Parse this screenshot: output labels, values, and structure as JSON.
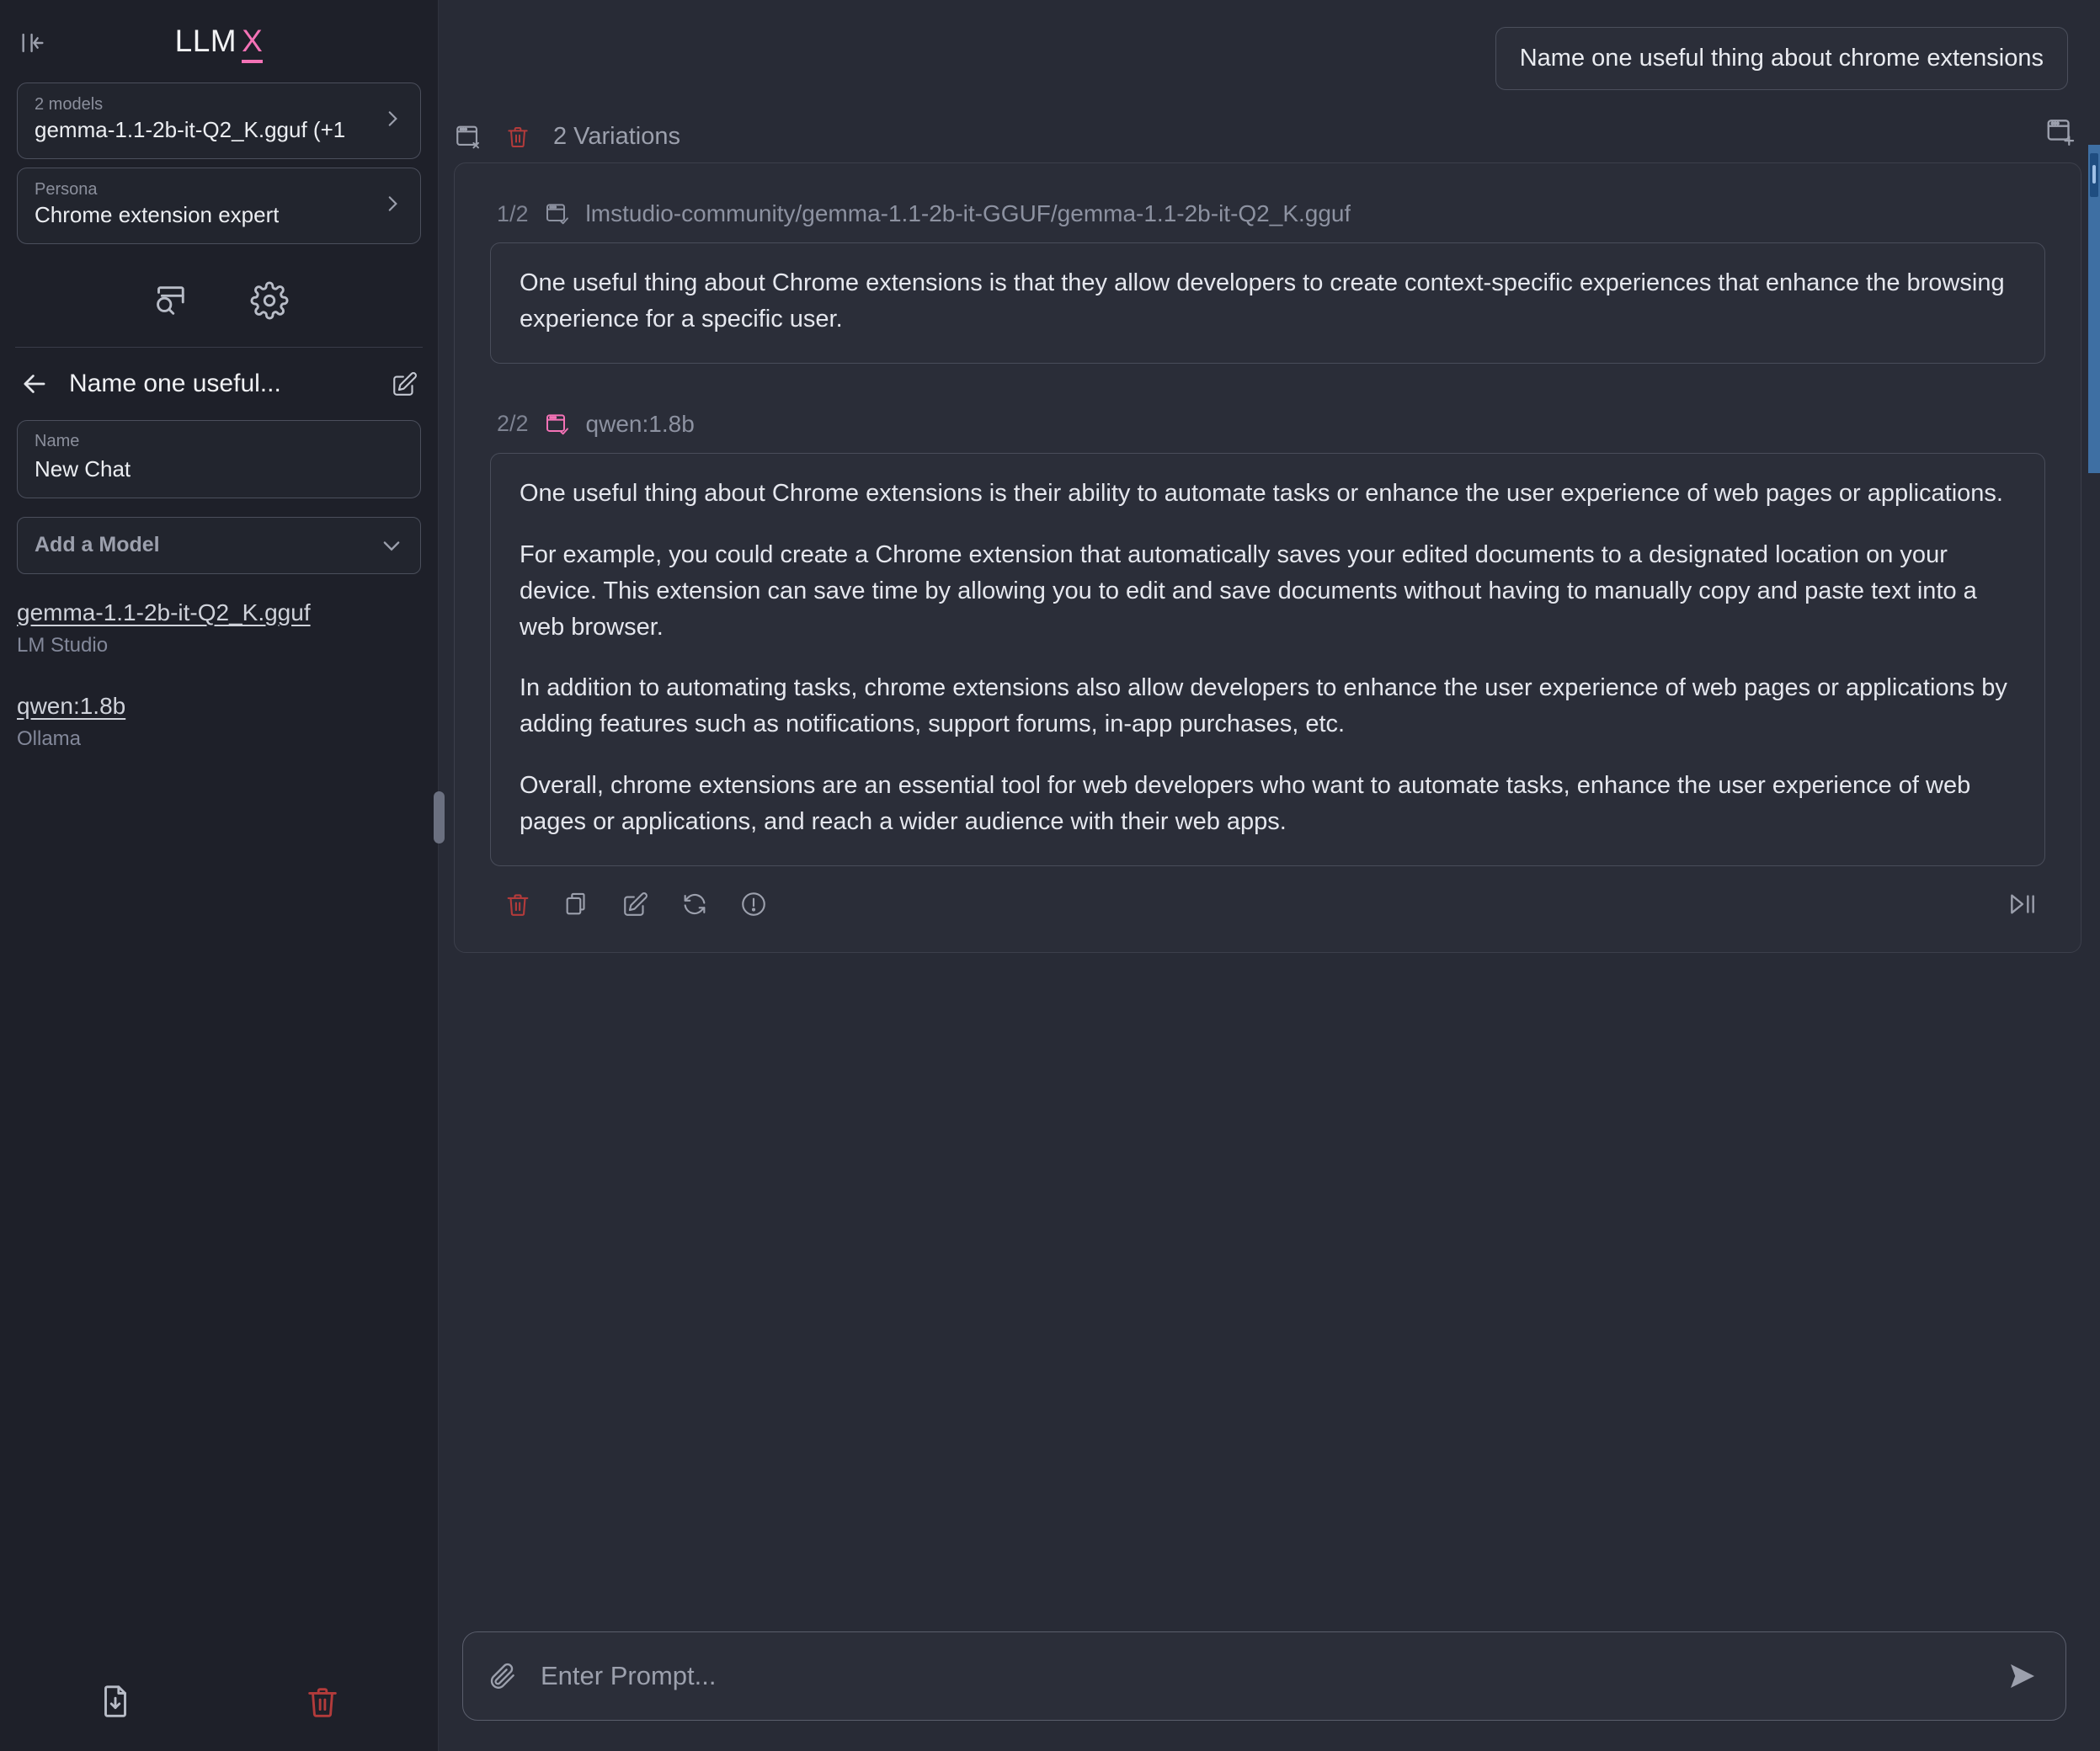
{
  "app": {
    "brand_name": "LLM",
    "brand_accent": "X",
    "accent_color": "#f472b6",
    "danger_color": "#b33b3b"
  },
  "sidebar": {
    "collapse_icon": "collapse-panel-icon",
    "model_selector": {
      "label": "2 models",
      "value": "gemma-1.1-2b-it-Q2_K.gguf (+1",
      "chevron": "chevron-right-icon"
    },
    "persona_selector": {
      "label": "Persona",
      "value": "Chrome extension expert",
      "chevron": "chevron-right-icon"
    },
    "quick_icons": [
      {
        "name": "prompt-search-icon"
      },
      {
        "name": "settings-gear-icon"
      }
    ],
    "chat": {
      "back_icon": "back-arrow-icon",
      "title": "Name one useful...",
      "edit_icon": "edit-pencil-icon",
      "name_field": {
        "label": "Name",
        "value": "New Chat"
      },
      "add_model": {
        "label": "Add a Model",
        "chevron": "chevron-down-icon"
      },
      "models": [
        {
          "name": "gemma-1.1-2b-it-Q2_K.gguf",
          "provider": "LM Studio"
        },
        {
          "name": "qwen:1.8b",
          "provider": "Ollama"
        }
      ]
    },
    "footer_icons": [
      {
        "name": "export-download-icon"
      },
      {
        "name": "delete-trash-icon"
      }
    ]
  },
  "main": {
    "user_message": "Name one useful thing about chrome extensions",
    "variations_header": {
      "close_icon": "window-close-icon",
      "delete_icon": "delete-trash-icon",
      "label": "2 Variations",
      "add_icon": "window-add-icon"
    },
    "variations": [
      {
        "index": "1/2",
        "status_icon": "window-check-icon",
        "model": "lmstudio-community/gemma-1.1-2b-it-GGUF/gemma-1.1-2b-it-Q2_K.gguf",
        "selected": false,
        "paragraphs": [
          "One useful thing about Chrome extensions is that they allow developers to create context-specific experiences that enhance the browsing experience for a specific user."
        ]
      },
      {
        "index": "2/2",
        "status_icon": "window-check-icon",
        "model": "qwen:1.8b",
        "selected": true,
        "paragraphs": [
          "One useful thing about Chrome extensions is their ability to automate tasks or enhance the user experience of web pages or applications.",
          "For example, you could create a Chrome extension that automatically saves your edited documents to a designated location on your device. This extension can save time by allowing you to edit and save documents without having to manually copy and paste text into a web browser.",
          "In addition to automating tasks, chrome extensions also allow developers to enhance the user experience of web pages or applications by adding features such as notifications, support forums, in-app purchases, etc.",
          "Overall, chrome extensions are an essential tool for web developers who want to automate tasks, enhance the user experience of web pages or applications, and reach a wider audience with their web apps."
        ],
        "actions": [
          {
            "name": "delete-response-icon"
          },
          {
            "name": "copy-response-icon"
          },
          {
            "name": "edit-response-icon"
          },
          {
            "name": "regenerate-response-icon"
          },
          {
            "name": "response-info-icon"
          }
        ],
        "play_pause_icon": "play-pause-icon"
      }
    ],
    "prompt": {
      "attach_icon": "paperclip-icon",
      "placeholder": "Enter Prompt...",
      "value": "",
      "send_icon": "send-arrow-icon"
    }
  }
}
